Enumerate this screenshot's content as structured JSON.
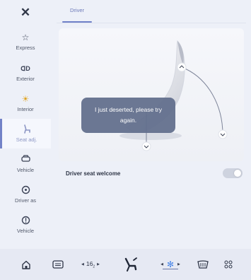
{
  "sidebar": {
    "close_icon": "close-icon",
    "items": [
      {
        "label": "Express",
        "icon": "star-icon",
        "glyph": "☆"
      },
      {
        "label": "Exterior",
        "icon": "lights-icon",
        "glyph": "ᗡD"
      },
      {
        "label": "Interior",
        "icon": "sun-icon",
        "glyph": "☀"
      },
      {
        "label": "Seat adj.",
        "icon": "seat-icon",
        "glyph": "⚲",
        "active": true
      },
      {
        "label": "Vehicle",
        "icon": "car-icon",
        "glyph": "▭"
      },
      {
        "label": "Driver as",
        "icon": "steering-wheel-icon",
        "glyph": "◎"
      },
      {
        "label": "Vehicle",
        "icon": "info-icon",
        "glyph": "ⓘ"
      }
    ]
  },
  "tabs": [
    {
      "label": "Driver",
      "active": true
    }
  ],
  "toast": {
    "message": "I just deserted, please try again."
  },
  "settings": {
    "driver_seat_welcome": {
      "label": "Driver seat welcome",
      "enabled": false
    }
  },
  "bottom_bar": {
    "temperature": "16",
    "temp_unit_small": "2",
    "colors": {
      "fan": "#4a86e8",
      "accent": "#6f80c8"
    }
  }
}
